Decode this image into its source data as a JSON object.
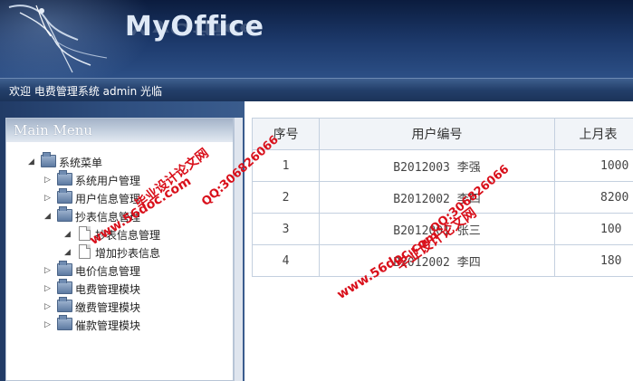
{
  "header": {
    "brand": "MyOffice"
  },
  "welcome_bar": {
    "text": "欢迎 电费管理系统 admin 光临"
  },
  "menu": {
    "title": "Main Menu",
    "items": [
      {
        "label": "系统菜单",
        "level": 0,
        "type": "folder",
        "expanded": true
      },
      {
        "label": "系统用户管理",
        "level": 1,
        "type": "folder",
        "expanded": false
      },
      {
        "label": "用户信息管理",
        "level": 1,
        "type": "folder",
        "expanded": false
      },
      {
        "label": "抄表信息管理",
        "level": 1,
        "type": "folder",
        "expanded": true
      },
      {
        "label": "抄表信息管理",
        "level": 2,
        "type": "doc"
      },
      {
        "label": "增加抄表信息",
        "level": 2,
        "type": "doc"
      },
      {
        "label": "电价信息管理",
        "level": 1,
        "type": "folder",
        "expanded": false
      },
      {
        "label": "电费管理模块",
        "level": 1,
        "type": "folder",
        "expanded": false
      },
      {
        "label": "缴费管理模块",
        "level": 1,
        "type": "folder",
        "expanded": false
      },
      {
        "label": "催款管理模块",
        "level": 1,
        "type": "folder",
        "expanded": false
      }
    ]
  },
  "table": {
    "headers": [
      "序号",
      "用户编号",
      "上月表"
    ],
    "rows": [
      {
        "no": "1",
        "user_code": "B2012003",
        "user_name": "李强",
        "last_reading": "1000"
      },
      {
        "no": "2",
        "user_code": "B2012002",
        "user_name": "李四",
        "last_reading": "8200"
      },
      {
        "no": "3",
        "user_code": "B2012001",
        "user_name": "张三",
        "last_reading": "100"
      },
      {
        "no": "4",
        "user_code": "B2012002",
        "user_name": "李四",
        "last_reading": "180"
      }
    ]
  },
  "watermark": {
    "site": "www.56doc.com",
    "qq": "QQ:306826066",
    "slogan": "毕业设计论文网"
  }
}
